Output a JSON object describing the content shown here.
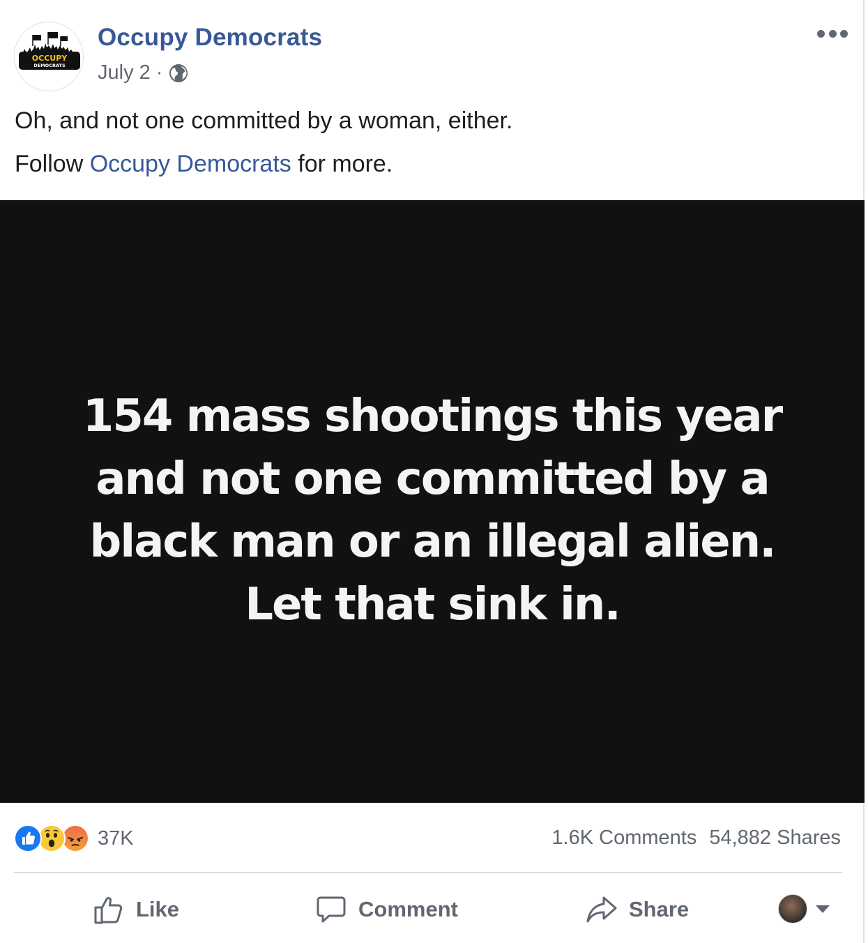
{
  "post": {
    "page_name": "Occupy Democrats",
    "date": "July 2",
    "separator": "·",
    "privacy_icon": "globe-icon",
    "logo_text_top": "OCCUPY",
    "logo_text_bottom": "DEMOCRATS",
    "text_line1": "Oh, and not one committed by a woman, either.",
    "text_line2_prefix": "Follow ",
    "text_line2_link": "Occupy Democrats",
    "text_line2_suffix": " for more."
  },
  "image": {
    "lines": [
      "154 mass shootings this year",
      "and not one committed by a",
      "black man or an illegal alien.",
      "Let that sink in."
    ]
  },
  "engagement": {
    "reaction_icons": [
      "like-reaction-icon",
      "wow-reaction-icon",
      "angry-reaction-icon"
    ],
    "reaction_count": "37K",
    "comments": "1.6K Comments",
    "shares": "54,882 Shares"
  },
  "actions": {
    "like": "Like",
    "comment": "Comment",
    "share": "Share"
  },
  "colors": {
    "link": "#385898",
    "text": "#1c1e21",
    "muted": "#606770",
    "image_bg": "#111111",
    "like_blue": "#1877f2"
  }
}
